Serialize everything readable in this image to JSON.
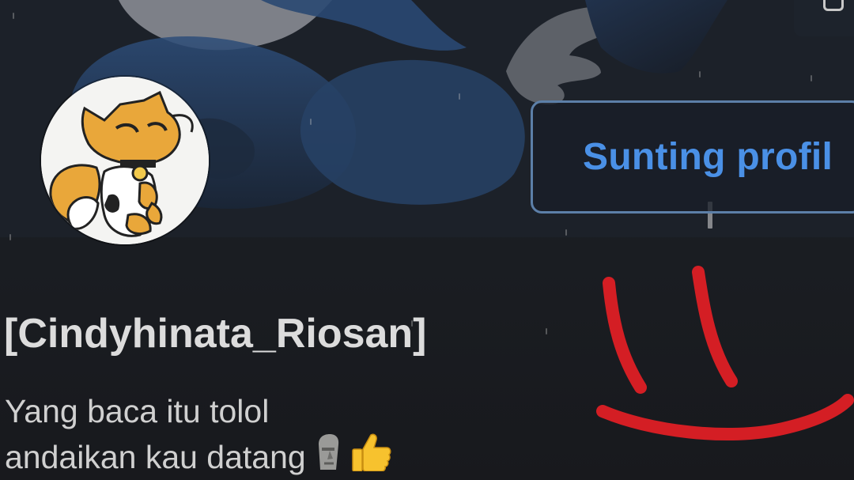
{
  "profile": {
    "username": "[Cindyhinata_Riosan]",
    "bio_line_1": "Yang baca itu tolol",
    "bio_line_2": "andaikan kau datang",
    "bio_emojis": [
      "moai-icon",
      "thumbs-up-icon"
    ]
  },
  "actions": {
    "edit_profile_label": "Sunting profil"
  },
  "colors": {
    "accent": "#4a90e6",
    "button_border": "#5c7fa8",
    "drawing": "#d41e24",
    "banner_blue": "#27446b",
    "avatar_orange": "#e9a73a"
  }
}
